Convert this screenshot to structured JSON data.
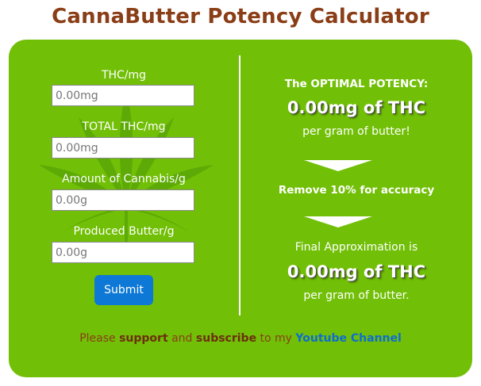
{
  "page": {
    "title": "CannaButter Potency Calculator"
  },
  "form": {
    "fields": [
      {
        "label": "THC/mg",
        "placeholder": "0.00mg"
      },
      {
        "label": "TOTAL THC/mg",
        "placeholder": "0.00mg"
      },
      {
        "label": "Amount of Cannabis/g",
        "placeholder": "0.00g"
      },
      {
        "label": "Produced Butter/g",
        "placeholder": "0.00g"
      }
    ],
    "submit_label": "Submit"
  },
  "results": {
    "optimal_heading": "The OPTIMAL POTENCY:",
    "optimal_value": "0.00mg of THC",
    "optimal_unit": "per gram of butter!",
    "adjustment_note": "Remove 10% for accuracy",
    "final_heading": "Final Approximation is",
    "final_value": "0.00mg of THC",
    "final_unit": "per gram of butter."
  },
  "footer": {
    "prefix": "Please ",
    "support": "support",
    "and": " and ",
    "subscribe": "subscribe",
    "to_my": " to my ",
    "channel_link": "Youtube Channel"
  },
  "colors": {
    "title": "#8a3e17",
    "panel": "#71bf06",
    "button": "#0d78d6",
    "link": "#0d6ecf"
  },
  "icons": {
    "background": "cannabis-leaf-icon",
    "flow": "down-arrow-icon"
  }
}
